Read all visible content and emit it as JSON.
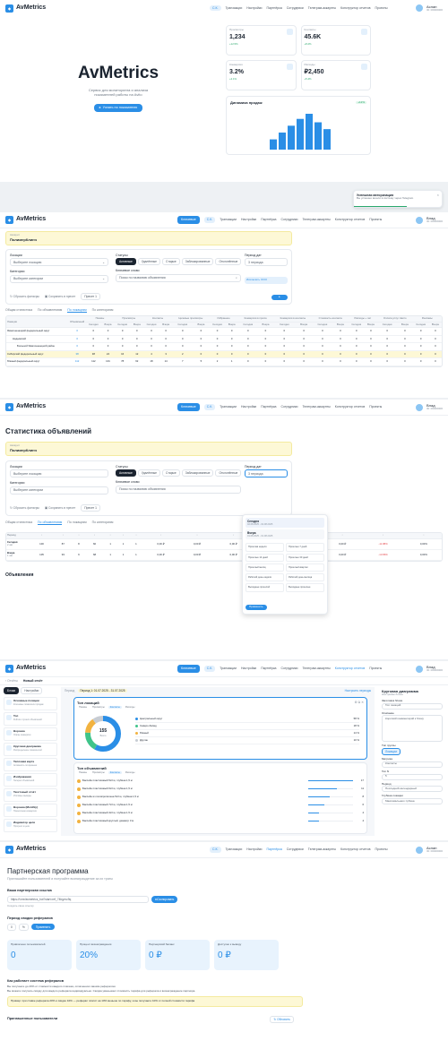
{
  "nav": {
    "brand": "AvMetrics",
    "city": "С.К.",
    "items": [
      "Транзакции",
      "Настройки",
      "Партнёрка",
      "Сотрудники",
      "Телеграм-аккаунты",
      "Конструктор отчетов",
      "Проекты"
    ],
    "sub": "Ключевые",
    "user_a": "Аслан",
    "user_a_id": "ID: 00000000",
    "user_v": "Влад",
    "user_v_id": "ID: 00000000"
  },
  "hero": {
    "title": "AvMetrics",
    "subtitle": "Сервис для мониторинга и анализа показателей работы на Avito",
    "cta": "Узнать по показателю",
    "kpis": [
      {
        "label": "Просмотры",
        "value": "1,234",
        "delta": "+12.5%"
      },
      {
        "label": "Контакты",
        "value": "45.6K",
        "delta": "+8.2%"
      },
      {
        "label": "Конверсия",
        "value": "3.2%",
        "delta": "+2.1%"
      },
      {
        "label": "Расходы",
        "value": "₽2,450",
        "delta": "+5.4%"
      }
    ],
    "chart_title": "Динамика продаж",
    "chart_badge": "+12%",
    "chart_data": {
      "type": "bar",
      "values": [
        6,
        10,
        14,
        18,
        21,
        16,
        12
      ]
    },
    "toast_title": "Успешная авторизация",
    "toast_text": "Вы успешно вошли в систему через Telegram"
  },
  "s2": {
    "account_label": "Аккаунт",
    "account": "ПолимерКлинч",
    "locations_label": "Локации",
    "locations_ph": "Выберите локацию",
    "statuses_label": "Статусы",
    "statuses": [
      "Активные",
      "Удалённые",
      "Старые",
      "Заблокированные",
      "Отклонённые"
    ],
    "period_label": "Период дат",
    "period": "3 периода",
    "categories_label": "Категории",
    "categories_ph": "Выберите категории",
    "keyword_label": "Ключевое слово",
    "keyword_ph": "Поиск по названию объявления",
    "reset": "Сбросить фильтры",
    "save": "Сохранить в пресет",
    "preset": "Пресет 1",
    "exclude": "Исключить ООО",
    "tabs": [
      "Общая статистика",
      "По объявлениям",
      "По локациям",
      "По категориям"
    ],
    "col_location": "Локация",
    "col_ads": "Объявлений",
    "groups": [
      "Показы",
      "Просмотры",
      "Контакты",
      "Целевые просмотры",
      "Избранное",
      "Конверсия в просм.",
      "Конверсия в контакты",
      "Стоимость контакта",
      "Расходы + чат",
      "Оплата услуг Авито",
      "Рекламы"
    ],
    "sub": [
      "Сегодня",
      "Вчера"
    ],
    "rows": [
      {
        "name": "Ямалоненецкий федеральный округ",
        "ads": "0",
        "v": [
          "0",
          "0",
          "0",
          "0",
          "0",
          "0",
          "0",
          "0",
          "0",
          "0",
          "0",
          "0",
          "0",
          "0",
          "0",
          "0",
          "0",
          "0",
          "0",
          "0",
          "0",
          "0"
        ]
      },
      {
        "name": "Надымский",
        "ads": "0",
        "v": [
          "0",
          "0",
          "0",
          "0",
          "0",
          "0",
          "0",
          "0",
          "0",
          "0",
          "0",
          "0",
          "0",
          "0",
          "0",
          "0",
          "0",
          "0",
          "0",
          "0",
          "0",
          "0"
        ]
      },
      {
        "name": "Большой Ямалоненецкий район",
        "ads": "0",
        "v": [
          "0",
          "0",
          "0",
          "0",
          "0",
          "0",
          "0",
          "0",
          "0",
          "0",
          "0",
          "0",
          "0",
          "0",
          "0",
          "0",
          "0",
          "0",
          "0",
          "0",
          "0",
          "0"
        ]
      },
      {
        "name": "Сибирский федеральный округ",
        "ads": "38",
        "v": [
          "38",
          "24",
          "16",
          "12",
          "4",
          "3",
          "2",
          "0",
          "0",
          "0",
          "0",
          "0",
          "0",
          "0",
          "0",
          "0",
          "0",
          "0",
          "0",
          "0",
          "0",
          "0"
        ]
      },
      {
        "name": "Южный федеральный округ",
        "ads": "112",
        "v": [
          "112",
          "101",
          "78",
          "62",
          "18",
          "14",
          "7",
          "5",
          "2",
          "1",
          "0",
          "0",
          "0",
          "0",
          "0",
          "0",
          "0",
          "0",
          "0",
          "0",
          "0",
          "0"
        ]
      }
    ]
  },
  "s3": {
    "title": "Статистика объявлений",
    "account_label": "Аккаунт",
    "account": "ПолимерКлинч",
    "tabs": [
      "Общая статистика",
      "По объявлениям",
      "По локациям",
      "По категориям"
    ],
    "period_options": [
      {
        "label": "Сегодня",
        "date": "02.08.2025 - 02.08.2025"
      },
      {
        "label": "Вчера",
        "date": "01.08.2025 - 01.08.2025"
      }
    ],
    "period_grid": [
      "Прошлая неделя",
      "Прошлые 7 дней",
      "Прошлые 14 дней",
      "Прошлые 30 дней",
      "Прошлый месяц",
      "Прошлый квартал",
      "Рабочий день недели",
      "Рабочий день месяца",
      "Выходные прошлой",
      "Выходные прошлые"
    ],
    "apply": "Применить",
    "col_period": "Период",
    "rows": [
      {
        "label": "Сегодня",
        "date": "2 авг",
        "v": [
          "100",
          "87",
          "8",
          "60",
          "1",
          "1",
          "1",
          "0,00 ₽",
          "0,00 ₽",
          "0,00 ₽",
          "0,00 ₽",
          "0,00 ₽",
          "0,00 ₽",
          "-11.88%",
          "0,00%"
        ]
      },
      {
        "label": "Вчера",
        "date": "1 авг",
        "v": [
          "105",
          "93",
          "9",
          "68",
          "1",
          "1",
          "1",
          "0,00 ₽",
          "0,00 ₽",
          "0,00 ₽",
          "0,00 ₽",
          "0,00 ₽",
          "0,00 ₽",
          "-13.86%",
          "0,00%"
        ]
      }
    ],
    "section": "Объявления"
  },
  "s4": {
    "back": "Отчёты",
    "report": "Новый отчёт",
    "tab_blocks": "Блоки",
    "tab_settings": "Настройки",
    "period_label": "Период",
    "period_chip": "Период 1: 01.07.2025 - 31.07.2025",
    "view": "Настроить периоды",
    "blocks": [
      {
        "t": "Основные позиции",
        "d": "Ключевые показатели продаж"
      },
      {
        "t": "Топ",
        "d": "Рейтинг лучших объявлений"
      },
      {
        "t": "Воронка",
        "d": "Этапы конверсии"
      },
      {
        "t": "Круговая диаграмма",
        "d": "Распределение показателей"
      },
      {
        "t": "Тепловая карта",
        "d": "Активность по времени"
      },
      {
        "t": "Изображения",
        "d": "Галерея объявлений"
      },
      {
        "t": "Текстовый отчёт",
        "d": "Итоговые выводы"
      },
      {
        "t": "Воронка (Monthly)",
        "d": "Помесячная конверсия"
      },
      {
        "t": "Индикатор цели",
        "d": "Прогресс к цели"
      }
    ],
    "top_title": "Топ локаций",
    "top_tabs": [
      "Показы",
      "Просмотры",
      "Контакты",
      "Расходы"
    ],
    "donut_total": "155",
    "donut_sub": "Всего",
    "legend": [
      {
        "l": "Центральный округ",
        "v": "58 %",
        "c": "#2a8ee6"
      },
      {
        "l": "Северо-Запад",
        "v": "18 %",
        "c": "#3fc48a"
      },
      {
        "l": "Южный",
        "v": "14 %",
        "c": "#f2b340"
      },
      {
        "l": "Другие",
        "v": "10 %",
        "c": "#c7ccd3"
      }
    ],
    "list_title": "Топ объявлений",
    "list_tabs": [
      "Показы",
      "Просмотры",
      "Контакты",
      "Расходы"
    ],
    "list": [
      {
        "t": "Бассейн пластиковый 5x3 м, глубина 1,5 м",
        "v": "17"
      },
      {
        "t": "Бассейн пластиковый 6x3 м, глубина 1,5 м",
        "v": "11"
      },
      {
        "t": "Бассейн из полипропилена 5x3 м, глубина 1,5 м",
        "v": "8"
      },
      {
        "t": "Бассейн пластиковый 7x3 м, глубина 1,5 м",
        "v": "6"
      },
      {
        "t": "Бассейн пластиковый 4x3 м, глубина 1,5 м",
        "v": "4"
      },
      {
        "t": "Бассейн пластиковый круглый, диаметр 3 м",
        "v": "4"
      }
    ],
    "panel_title": "Круговая диаграмма",
    "panel_sub": "Настройки блока",
    "name_label": "Заголовок блока",
    "name_val": "Топ локаций",
    "desc_label": "Описание",
    "desc_val": "Короткий комментарий к блоку",
    "type_label": "Тип группы",
    "type_val": "Локации",
    "metric_label": "Метрика",
    "metric_val": "Контакты",
    "top_label": "Топ N",
    "top_val": "5",
    "period_label2": "Период",
    "period_val": "Последний календарный",
    "depth_label": "Глубина локации",
    "depth_val": "Максимальная глубина"
  },
  "s5": {
    "title": "Партнерская программа",
    "subtitle": "Приглашайте пользователей и получайте вознаграждение за их траты",
    "link_label": "Ваша партнерская ссылка",
    "link": "https://t.me/avmetrics_bot?start=ref_74bgvvc9q",
    "copy": "Скопировать",
    "code_label": "Создать свою ссылку",
    "period_label": "Период сводки рефералов",
    "period_vals": [
      "0",
      "%"
    ],
    "apply": "Применить",
    "stats": [
      {
        "l": "Привлечено пользователей",
        "v": "0"
      },
      {
        "l": "Процент вознаграждения",
        "v": "20%"
      },
      {
        "l": "Партнерский баланс",
        "v": "0 ₽"
      },
      {
        "l": "Доступно к выводу",
        "v": "0 ₽"
      }
    ],
    "how_title": "Как работает система рефералов",
    "how": [
      "Вы получаете до 20% от стоимости каждого платежа, оплаченного вашим рефералом.",
      "Вы можете получать скидку для каждого реферала индивидуально. Скидка уменьшает стоимость тарифа для реферала и вознаграждение партнёра."
    ],
    "example": "Пример: при ставке реферала 20% и скидке 10% — реферал платит на 10% меньше по тарифу, а вы получаете 10% от полной стоимости тарифа",
    "invited_title": "Приглашенные пользователи",
    "refresh": "Обновить"
  }
}
